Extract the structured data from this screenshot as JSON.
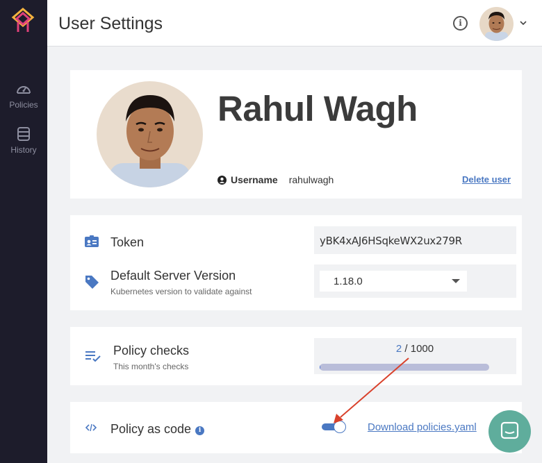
{
  "sidebar": {
    "items": [
      {
        "label": "Policies",
        "icon": "speedometer-icon"
      },
      {
        "label": "History",
        "icon": "database-icon"
      }
    ]
  },
  "header": {
    "title": "User Settings",
    "info_icon": "info-circle-icon",
    "avatar_icon": "user-avatar",
    "menu_icon": "chevron-down-icon"
  },
  "profile": {
    "name": "Rahul Wagh",
    "username_label": "Username",
    "username_value": "rahulwagh",
    "delete_label": "Delete user"
  },
  "settings": {
    "token_label": "Token",
    "token_value": "yBK4xAJ6HSqkeWX2ux279R",
    "server_version_label": "Default Server Version",
    "server_version_sub": "Kubernetes version to validate against",
    "server_version_value": "1.18.0"
  },
  "checks": {
    "label": "Policy checks",
    "sub": "This month's checks",
    "used": "2",
    "separator": " / ",
    "total": "1000",
    "fraction_used": 0.002
  },
  "policy_code": {
    "label": "Policy as code",
    "toggle_on": true,
    "download_label": "Download policies.yaml"
  },
  "colors": {
    "sidebar_bg": "#1d1c2b",
    "accent": "#4a78c2",
    "annotation_arrow": "#d9412b",
    "chat_button": "#5fad9c"
  }
}
